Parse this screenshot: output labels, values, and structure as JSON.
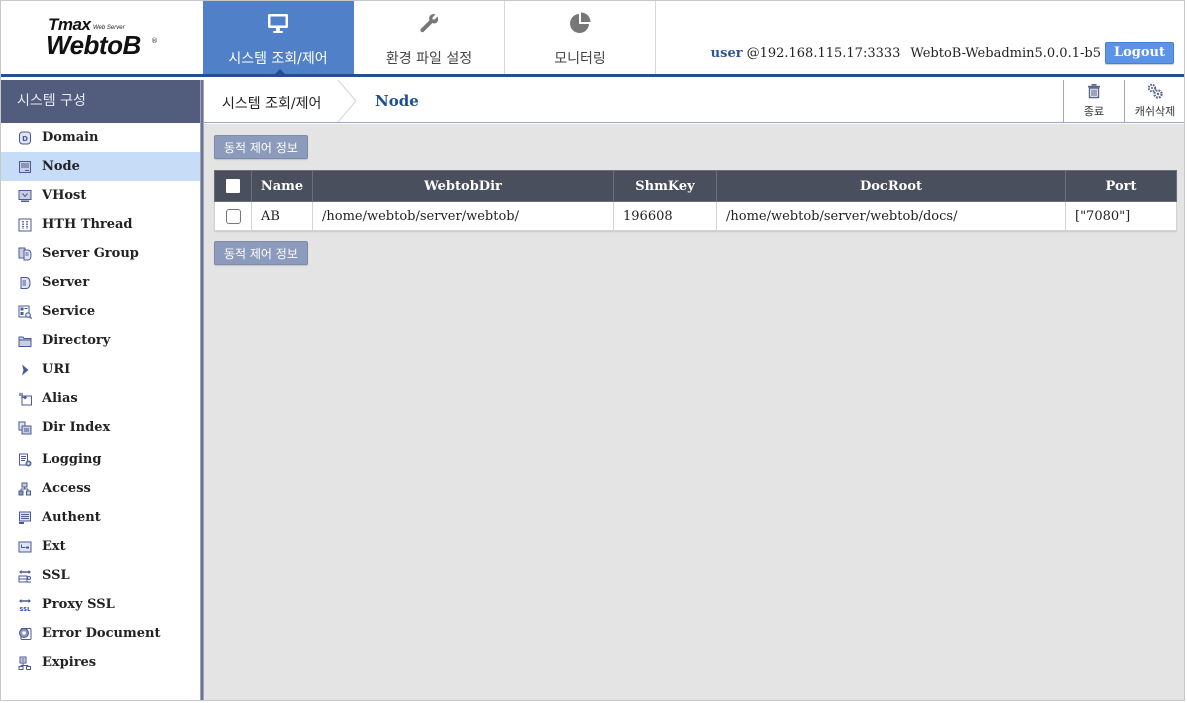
{
  "header": {
    "logo": {
      "top": "Tmax",
      "sub": "Web Server",
      "main": "WebtoB",
      "reg": "®"
    },
    "nav_tabs": [
      {
        "label": "시스템 조회/제어",
        "icon": "monitor-icon",
        "active": true
      },
      {
        "label": "환경 파일 설정",
        "icon": "wrench-icon",
        "active": false
      },
      {
        "label": "모니터링",
        "icon": "pie-chart-icon",
        "active": false
      }
    ],
    "user": "user",
    "host": "@192.168.115.17:3333",
    "version": "WebtoB-Webadmin5.0.0.1-b5",
    "logout_label": "Logout"
  },
  "sidebar": {
    "title": "시스템 구성",
    "items": [
      {
        "label": "Domain",
        "icon": "domain-icon",
        "active": false
      },
      {
        "label": "Node",
        "icon": "node-icon",
        "active": true
      },
      {
        "label": "VHost",
        "icon": "vhost-icon",
        "active": false
      },
      {
        "label": "HTH Thread",
        "icon": "hth-thread-icon",
        "active": false
      },
      {
        "label": "Server Group",
        "icon": "server-group-icon",
        "active": false
      },
      {
        "label": "Server",
        "icon": "server-icon",
        "active": false
      },
      {
        "label": "Service",
        "icon": "service-icon",
        "active": false
      },
      {
        "label": "Directory",
        "icon": "folder-icon",
        "active": false
      },
      {
        "label": "URI",
        "icon": "uri-icon",
        "active": false
      },
      {
        "label": "Alias",
        "icon": "alias-icon",
        "active": false
      },
      {
        "label": "Dir Index",
        "icon": "dir-index-icon",
        "active": false
      },
      {
        "label": "Logging",
        "icon": "logging-icon",
        "active": false
      },
      {
        "label": "Access",
        "icon": "access-icon",
        "active": false
      },
      {
        "label": "Authent",
        "icon": "authent-icon",
        "active": false
      },
      {
        "label": "Ext",
        "icon": "ext-icon",
        "active": false
      },
      {
        "label": "SSL",
        "icon": "ssl-icon",
        "active": false
      },
      {
        "label": "Proxy SSL",
        "icon": "proxy-ssl-icon",
        "active": false
      },
      {
        "label": "Error Document",
        "icon": "error-document-icon",
        "active": false
      },
      {
        "label": "Expires",
        "icon": "expires-icon",
        "active": false
      }
    ]
  },
  "breadcrumb": {
    "parent": "시스템 조회/제어",
    "current": "Node"
  },
  "toolbar": {
    "terminate_label": "종료",
    "cache_delete_label": "캐쉬삭제"
  },
  "main": {
    "action_label": "동적 제어 정보",
    "table": {
      "columns": [
        "Name",
        "WebtobDir",
        "ShmKey",
        "DocRoot",
        "Port"
      ],
      "rows": [
        {
          "name": "AB",
          "webtobdir": "/home/webtob/server/webtob/",
          "shmkey": "196608",
          "docroot": "/home/webtob/server/webtob/docs/",
          "port": "[\"7080\"]"
        }
      ]
    }
  },
  "colors": {
    "accent": "#5080c8",
    "header_rule": "#274f8f",
    "sidebar_title_bg": "#525c7d",
    "active_item_bg": "#c6dcf7",
    "table_header_bg": "#4a4f5e",
    "action_button_bg": "#8c9bbb",
    "logout_bg": "#5b93e6"
  }
}
